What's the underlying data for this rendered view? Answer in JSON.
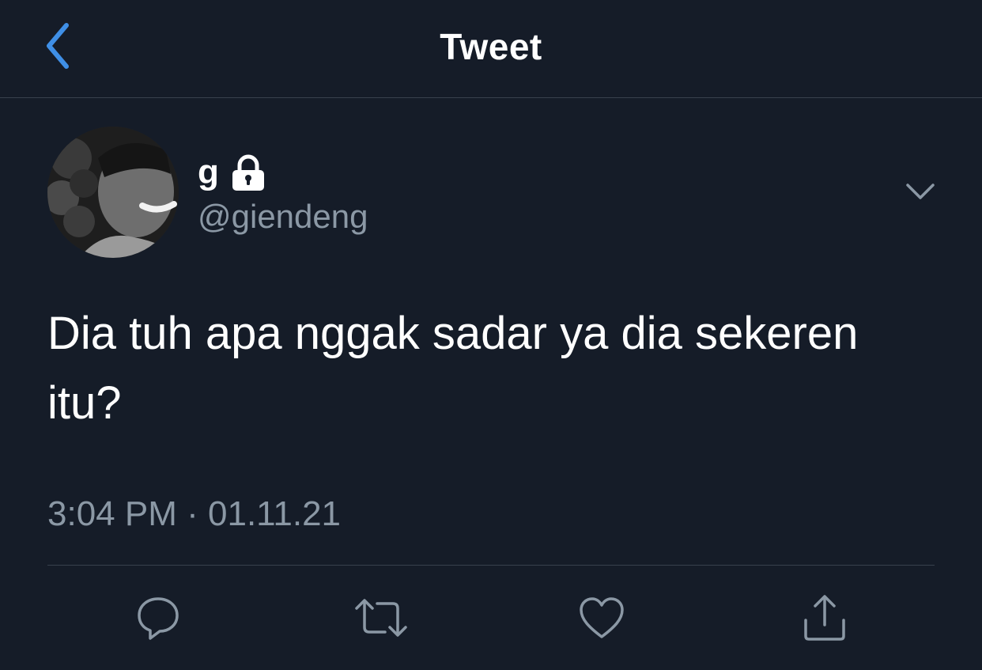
{
  "header": {
    "title": "Tweet",
    "back_icon": "chevron-left-icon"
  },
  "tweet": {
    "display_name": "g",
    "handle": "@giendeng",
    "protected_icon": "lock-icon",
    "text": "Dia tuh apa nggak sadar ya dia sekeren itu?",
    "time": "3:04 PM",
    "separator": "·",
    "date": "01.11.21"
  },
  "actions": [
    {
      "icon": "reply-icon"
    },
    {
      "icon": "retweet-icon"
    },
    {
      "icon": "like-icon"
    },
    {
      "icon": "share-icon"
    }
  ],
  "colors": {
    "background": "#151c28",
    "accent": "#1d9bf0",
    "secondary_text": "#8b98a5",
    "divider": "#38414d"
  }
}
